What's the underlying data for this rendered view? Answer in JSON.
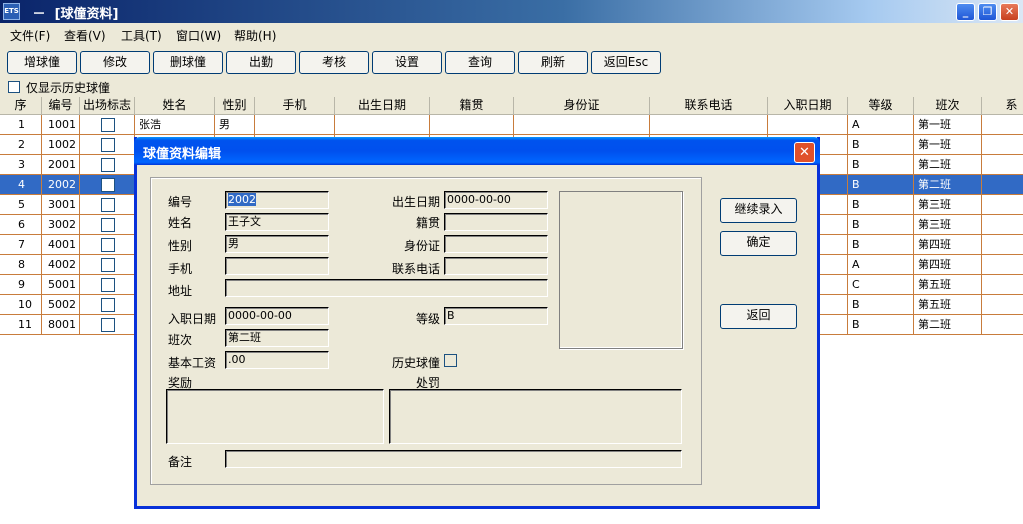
{
  "window": {
    "icon_text": "ETS",
    "title": " －  [球僮资料]"
  },
  "title_buttons": {
    "minimize": "_",
    "restore": "❐",
    "close": "✕"
  },
  "menu": [
    "文件(F)",
    "查看(V)",
    "工具(T)",
    "窗口(W)",
    "帮助(H)"
  ],
  "toolbar": [
    "增球僮",
    "修改",
    "删球僮",
    "出勤",
    "考核",
    "设置",
    "查询",
    "刷新",
    "返回Esc"
  ],
  "history_only_label": "仅显示历史球僮",
  "grid": {
    "columns": [
      "序",
      "编号",
      "出场标志",
      "姓名",
      "性别",
      "手机",
      "出生日期",
      "籍贯",
      "身份证",
      "联系电话",
      "入职日期",
      "等级",
      "班次",
      "系"
    ],
    "rows": [
      {
        "seq": "1",
        "id": "1001",
        "name": "张浩",
        "gender": "男",
        "grade": "A",
        "shift": "第一班"
      },
      {
        "seq": "2",
        "id": "1002",
        "name": "",
        "gender": "",
        "grade": "B",
        "shift": "第一班"
      },
      {
        "seq": "3",
        "id": "2001",
        "name": "",
        "gender": "",
        "grade": "B",
        "shift": "第二班"
      },
      {
        "seq": "4",
        "id": "2002",
        "name": "",
        "gender": "",
        "grade": "B",
        "shift": "第二班"
      },
      {
        "seq": "5",
        "id": "3001",
        "name": "",
        "gender": "",
        "grade": "B",
        "shift": "第三班"
      },
      {
        "seq": "6",
        "id": "3002",
        "name": "",
        "gender": "",
        "grade": "B",
        "shift": "第三班"
      },
      {
        "seq": "7",
        "id": "4001",
        "name": "",
        "gender": "",
        "grade": "B",
        "shift": "第四班"
      },
      {
        "seq": "8",
        "id": "4002",
        "name": "",
        "gender": "",
        "grade": "A",
        "shift": "第四班"
      },
      {
        "seq": "9",
        "id": "5001",
        "name": "",
        "gender": "",
        "grade": "C",
        "shift": "第五班"
      },
      {
        "seq": "10",
        "id": "5002",
        "name": "",
        "gender": "",
        "grade": "B",
        "shift": "第五班"
      },
      {
        "seq": "11",
        "id": "8001",
        "name": "",
        "gender": "",
        "grade": "B",
        "shift": "第二班"
      }
    ]
  },
  "dialog": {
    "title": "球僮资料编辑",
    "labels": {
      "id": "编号",
      "name": "姓名",
      "gender": "性别",
      "mobile": "手机",
      "address": "地址",
      "birth": "出生日期",
      "origin": "籍贯",
      "idcard": "身份证",
      "phone": "联系电话",
      "hire": "入职日期",
      "shift": "班次",
      "salary": "基本工资",
      "grade": "等级",
      "history": "历史球僮",
      "reward": "奖励",
      "penalty": "处罚",
      "remark": "备注"
    },
    "values": {
      "id": "2002",
      "name": "王子文",
      "gender": "男",
      "mobile": "",
      "address": "",
      "birth": "0000-00-00",
      "origin": "",
      "idcard": "",
      "phone": "",
      "hire": "0000-00-00",
      "shift": "第二班",
      "salary": ".00",
      "grade": "B",
      "remark": ""
    },
    "buttons": {
      "continue": "继续录入",
      "ok": "确定",
      "back": "返回"
    }
  },
  "colors": {
    "selection": "#316ac5",
    "titlebar": "#0a246a",
    "dialog_border": "#0831d9"
  }
}
